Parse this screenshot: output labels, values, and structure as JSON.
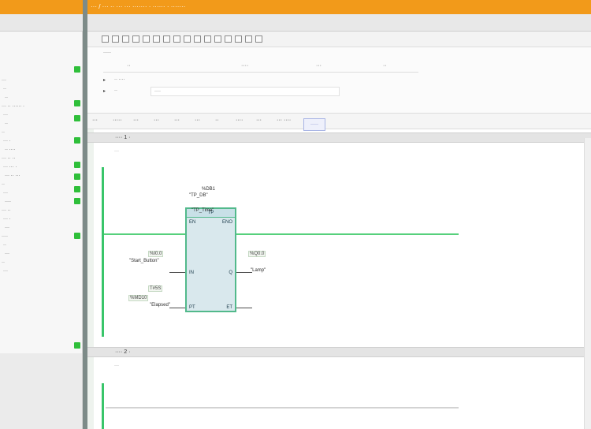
{
  "titlebar": {
    "text": "··· / ··· ·· ··· ··· ·······  ·  ······  ·  ·······"
  },
  "sidebar": {
    "items": [
      "···",
      "··",
      "··",
      "··· ·· ······ ·",
      "···",
      "··",
      "··",
      "··· ·",
      "·· ····",
      "··· ·· ··",
      "··· ··· ·",
      "··· ·· ···",
      "··",
      "···",
      "····",
      "··· ··",
      "··· ·",
      "···",
      "····",
      "··",
      "···",
      "··",
      "···"
    ],
    "footer": "·······"
  },
  "toolbar1": {
    "icons": [
      "go-online-icon",
      "go-offline-icon",
      "monitor-icon",
      "compare-icon",
      "download-icon",
      "upload-icon",
      "insert-network-icon",
      "delete-network-icon",
      "contact-icon",
      "coil-icon",
      "box-icon",
      "open-branch-icon",
      "close-branch-icon",
      "zoom-in-icon",
      "zoom-out-icon",
      "settings-icon"
    ]
  },
  "interface": {
    "title": "·····",
    "headers": {
      "name": "··",
      "datatype": "····",
      "default": "···",
      "comment": "··"
    },
    "rows": [
      {
        "expander": "▸",
        "name": "·· ····",
        "value": ""
      },
      {
        "expander": "▸",
        "name": "··",
        "value": "····"
      }
    ]
  },
  "toolbar2": {
    "items": [
      "···",
      "·····",
      "···",
      "···",
      "···",
      "···",
      "··",
      "····",
      "···",
      "··· ····"
    ],
    "highlight": "·····"
  },
  "networks": [
    {
      "title": "···· 1 ·",
      "comment": "···"
    },
    {
      "title": "···· 2 ·",
      "comment": "···"
    }
  ],
  "block": {
    "instance_db": "%DB1",
    "instance_name": "\"TP_DB\"",
    "type": "TP",
    "type_name": "\"TP_Time\"",
    "pins": {
      "in": "IN",
      "pt": "PT",
      "q": "Q",
      "et": "ET",
      "en": "EN",
      "eno": "ENO"
    }
  },
  "operands": {
    "in_addr": "%I0.0",
    "in_name": "\"Start_Button\"",
    "pt_value": "T#5S",
    "q_addr": "%Q0.0",
    "q_name": "\"Lamp\"",
    "et_addr": "%MD10",
    "et_name": "\"Elapsed\""
  },
  "colors": {
    "titlebar": "#f29a1a",
    "rail": "#39c56a",
    "block_fill": "#d9e8ed",
    "block_border": "#52b98b"
  }
}
